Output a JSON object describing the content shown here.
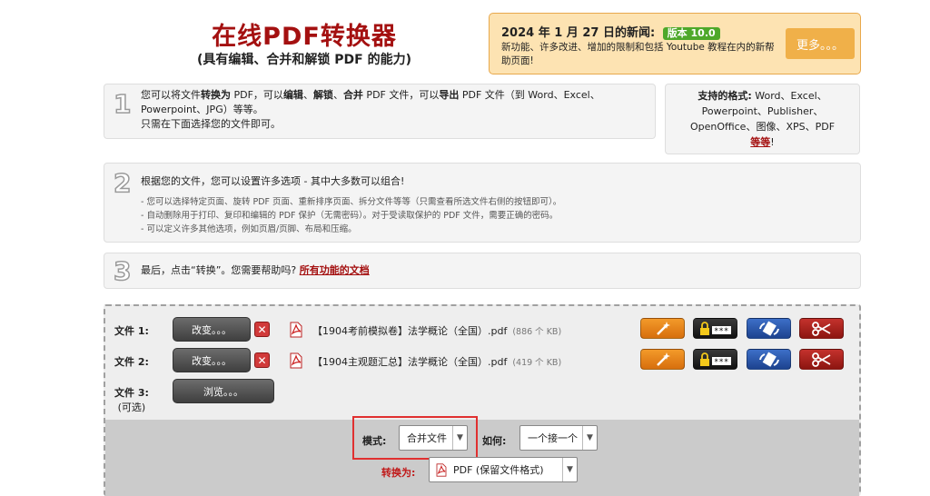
{
  "header": {
    "title": "在线PDF转换器",
    "subtitle": "(具有编辑、合并和解锁 PDF 的能力)"
  },
  "news": {
    "title": "2024 年 1 月 27 日的新闻:",
    "badge": "版本 10.0",
    "body": "新功能、许多改进、增加的限制和包括 Youtube 教程在内的新帮助页面!",
    "more_label": "更多。。。",
    "badge_color": "#4ea82a",
    "accent": "#f0b049"
  },
  "steps": {
    "step1": {
      "num": "1",
      "p1": "您可以将文件",
      "b1": "转换为",
      "p2": " PDF，可以",
      "b2": "编辑",
      "p3": "、",
      "b3": "解锁",
      "p4": "、",
      "b4": "合并",
      "p5": " PDF 文件，可以",
      "b5": "导出",
      "p6": " PDF 文件（到 Word、Excel、",
      "line2": "Powerpoint、JPG）等等。",
      "line3": "只需在下面选择您的文件即可。"
    },
    "formats": {
      "label": "支持的格式:",
      "list1": " Word、Excel、",
      "line2": "Powerpoint、Publisher、",
      "line3": "OpenOffice、图像、XPS、PDF",
      "more": "等等",
      "end": "!"
    },
    "step2": {
      "num": "2",
      "title": "根据您的文件，您可以设置许多选项 - 其中大多数可以组合!",
      "bullet1": "- 您可以选择特定页面、旋转 PDF 页面、重新排序页面、拆分文件等等（只需查看所选文件右侧的按钮即可）。",
      "bullet2": "- 自动删除用于打印、复印和编辑的 PDF 保护（无需密码）。对于受读取保护的 PDF 文件，需要正确的密码。",
      "bullet3": "- 可以定义许多其他选项，例如页眉/页脚、布局和压缩。"
    },
    "step3": {
      "num": "3",
      "text": "最后，点击“转换”。您需要帮助吗?",
      "link": "所有功能的文档"
    }
  },
  "files": [
    {
      "label": "文件 1:",
      "button": "改变。。。",
      "name": "【1904考前模拟卷】法学概论（全国）.pdf",
      "size": "(886 个 KB)"
    },
    {
      "label": "文件 2:",
      "button": "改变。。。",
      "name": "【1904主观题汇总】法学概论（全国）.pdf",
      "size": "(419 个 KB)"
    }
  ],
  "file3": {
    "label": "文件 3:",
    "optional": "(可选)",
    "button": "浏览。。。"
  },
  "options": {
    "mode_label": "模式:",
    "mode_value": "合并文件",
    "how_label": "如何:",
    "how_value": "一个接一个",
    "convert_label": "转换为:",
    "convert_value": "PDF (保留文件格式)"
  },
  "tool_icons": [
    "magic-wand-icon",
    "lock-password-icon",
    "rotate-page-icon",
    "scissors-icon"
  ],
  "colors": {
    "title": "#a41010",
    "highlight_border": "#e03030",
    "tool_orange": "#e0801a",
    "tool_blue": "#2a55a8",
    "tool_red": "#a8201b"
  }
}
